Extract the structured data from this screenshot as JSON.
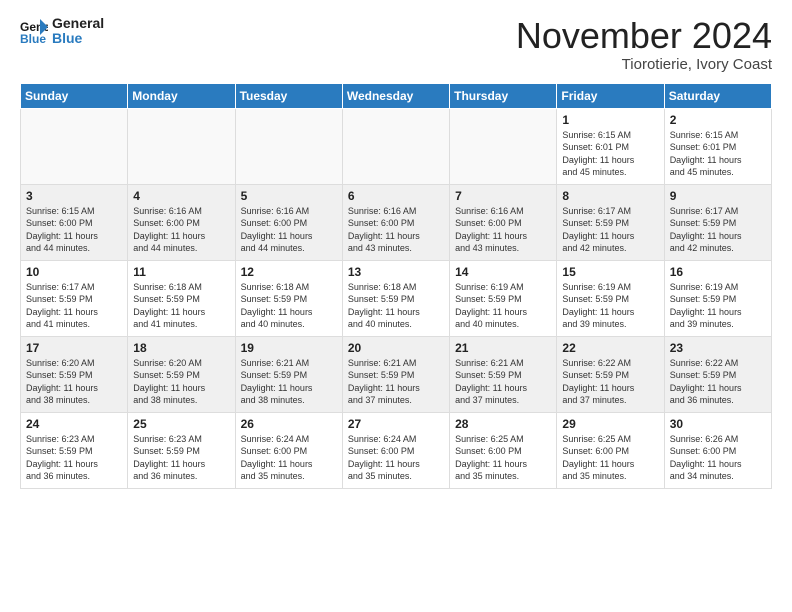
{
  "logo": {
    "line1": "General",
    "line2": "Blue"
  },
  "title": "November 2024",
  "location": "Tiorotierie, Ivory Coast",
  "days_header": [
    "Sunday",
    "Monday",
    "Tuesday",
    "Wednesday",
    "Thursday",
    "Friday",
    "Saturday"
  ],
  "weeks": [
    [
      {
        "num": "",
        "info": ""
      },
      {
        "num": "",
        "info": ""
      },
      {
        "num": "",
        "info": ""
      },
      {
        "num": "",
        "info": ""
      },
      {
        "num": "",
        "info": ""
      },
      {
        "num": "1",
        "info": "Sunrise: 6:15 AM\nSunset: 6:01 PM\nDaylight: 11 hours\nand 45 minutes."
      },
      {
        "num": "2",
        "info": "Sunrise: 6:15 AM\nSunset: 6:01 PM\nDaylight: 11 hours\nand 45 minutes."
      }
    ],
    [
      {
        "num": "3",
        "info": "Sunrise: 6:15 AM\nSunset: 6:00 PM\nDaylight: 11 hours\nand 44 minutes."
      },
      {
        "num": "4",
        "info": "Sunrise: 6:16 AM\nSunset: 6:00 PM\nDaylight: 11 hours\nand 44 minutes."
      },
      {
        "num": "5",
        "info": "Sunrise: 6:16 AM\nSunset: 6:00 PM\nDaylight: 11 hours\nand 44 minutes."
      },
      {
        "num": "6",
        "info": "Sunrise: 6:16 AM\nSunset: 6:00 PM\nDaylight: 11 hours\nand 43 minutes."
      },
      {
        "num": "7",
        "info": "Sunrise: 6:16 AM\nSunset: 6:00 PM\nDaylight: 11 hours\nand 43 minutes."
      },
      {
        "num": "8",
        "info": "Sunrise: 6:17 AM\nSunset: 5:59 PM\nDaylight: 11 hours\nand 42 minutes."
      },
      {
        "num": "9",
        "info": "Sunrise: 6:17 AM\nSunset: 5:59 PM\nDaylight: 11 hours\nand 42 minutes."
      }
    ],
    [
      {
        "num": "10",
        "info": "Sunrise: 6:17 AM\nSunset: 5:59 PM\nDaylight: 11 hours\nand 41 minutes."
      },
      {
        "num": "11",
        "info": "Sunrise: 6:18 AM\nSunset: 5:59 PM\nDaylight: 11 hours\nand 41 minutes."
      },
      {
        "num": "12",
        "info": "Sunrise: 6:18 AM\nSunset: 5:59 PM\nDaylight: 11 hours\nand 40 minutes."
      },
      {
        "num": "13",
        "info": "Sunrise: 6:18 AM\nSunset: 5:59 PM\nDaylight: 11 hours\nand 40 minutes."
      },
      {
        "num": "14",
        "info": "Sunrise: 6:19 AM\nSunset: 5:59 PM\nDaylight: 11 hours\nand 40 minutes."
      },
      {
        "num": "15",
        "info": "Sunrise: 6:19 AM\nSunset: 5:59 PM\nDaylight: 11 hours\nand 39 minutes."
      },
      {
        "num": "16",
        "info": "Sunrise: 6:19 AM\nSunset: 5:59 PM\nDaylight: 11 hours\nand 39 minutes."
      }
    ],
    [
      {
        "num": "17",
        "info": "Sunrise: 6:20 AM\nSunset: 5:59 PM\nDaylight: 11 hours\nand 38 minutes."
      },
      {
        "num": "18",
        "info": "Sunrise: 6:20 AM\nSunset: 5:59 PM\nDaylight: 11 hours\nand 38 minutes."
      },
      {
        "num": "19",
        "info": "Sunrise: 6:21 AM\nSunset: 5:59 PM\nDaylight: 11 hours\nand 38 minutes."
      },
      {
        "num": "20",
        "info": "Sunrise: 6:21 AM\nSunset: 5:59 PM\nDaylight: 11 hours\nand 37 minutes."
      },
      {
        "num": "21",
        "info": "Sunrise: 6:21 AM\nSunset: 5:59 PM\nDaylight: 11 hours\nand 37 minutes."
      },
      {
        "num": "22",
        "info": "Sunrise: 6:22 AM\nSunset: 5:59 PM\nDaylight: 11 hours\nand 37 minutes."
      },
      {
        "num": "23",
        "info": "Sunrise: 6:22 AM\nSunset: 5:59 PM\nDaylight: 11 hours\nand 36 minutes."
      }
    ],
    [
      {
        "num": "24",
        "info": "Sunrise: 6:23 AM\nSunset: 5:59 PM\nDaylight: 11 hours\nand 36 minutes."
      },
      {
        "num": "25",
        "info": "Sunrise: 6:23 AM\nSunset: 5:59 PM\nDaylight: 11 hours\nand 36 minutes."
      },
      {
        "num": "26",
        "info": "Sunrise: 6:24 AM\nSunset: 6:00 PM\nDaylight: 11 hours\nand 35 minutes."
      },
      {
        "num": "27",
        "info": "Sunrise: 6:24 AM\nSunset: 6:00 PM\nDaylight: 11 hours\nand 35 minutes."
      },
      {
        "num": "28",
        "info": "Sunrise: 6:25 AM\nSunset: 6:00 PM\nDaylight: 11 hours\nand 35 minutes."
      },
      {
        "num": "29",
        "info": "Sunrise: 6:25 AM\nSunset: 6:00 PM\nDaylight: 11 hours\nand 35 minutes."
      },
      {
        "num": "30",
        "info": "Sunrise: 6:26 AM\nSunset: 6:00 PM\nDaylight: 11 hours\nand 34 minutes."
      }
    ]
  ]
}
